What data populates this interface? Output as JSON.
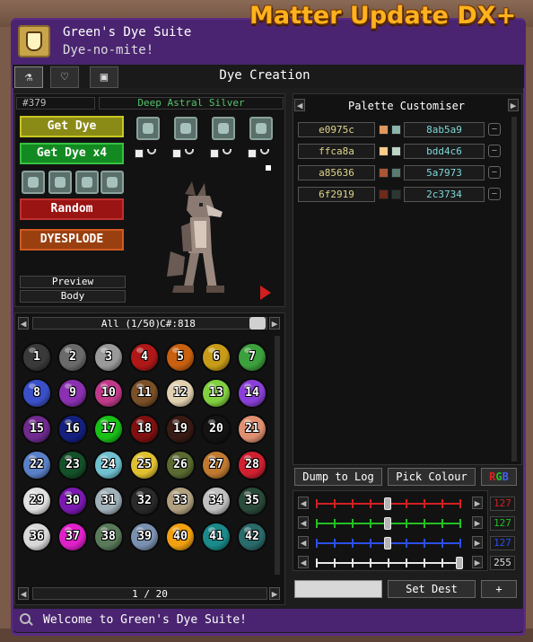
{
  "banner": {
    "text": "Matter Update DX+"
  },
  "window": {
    "title": "Green's Dye Suite",
    "subtitle": "Dye-no-mite!"
  },
  "tabs": [
    {
      "icon": "flask-icon",
      "active": true
    },
    {
      "icon": "heart-icon",
      "active": false
    },
    {
      "icon": "pot-icon",
      "active": false
    }
  ],
  "panel_title": "Dye Creation",
  "dye_header": {
    "id": "#379",
    "name": "Deep Astral Silver"
  },
  "buttons": {
    "get_dye": "Get Dye",
    "get_dye_x4": "Get Dye x4",
    "random": "Random",
    "dyesplode": "DYESPLODE"
  },
  "preview": {
    "label": "Preview",
    "slot": "Body"
  },
  "palette": {
    "title": "Palette Customiser",
    "rows": [
      {
        "from": "e0975c",
        "from_color": "#e0975c",
        "to": "8ab5a9",
        "to_color": "#8ab5a9"
      },
      {
        "from": "ffca8a",
        "from_color": "#ffca8a",
        "to": "bdd4c6",
        "to_color": "#bdd4c6"
      },
      {
        "from": "a85636",
        "from_color": "#a85636",
        "to": "5a7973",
        "to_color": "#5a7973"
      },
      {
        "from": "6f2919",
        "from_color": "#6f2919",
        "to": "2c3734",
        "to_color": "#2c3734"
      }
    ],
    "remove_label": "–"
  },
  "tools": {
    "dump": "Dump to Log",
    "pick": "Pick Colour",
    "mode": "RGB"
  },
  "sliders": [
    {
      "channel": "r",
      "color": "#d22020",
      "value": "127",
      "level": 0.5
    },
    {
      "channel": "g",
      "color": "#22c022",
      "value": "127",
      "level": 0.5
    },
    {
      "channel": "b",
      "color": "#2a50e8",
      "value": "127",
      "level": 0.5
    },
    {
      "channel": "a",
      "color": "#e8e8e8",
      "value": "255",
      "level": 1.0
    }
  ],
  "set_dest": {
    "label": "Set Dest",
    "plus": "+"
  },
  "list": {
    "filter": "All (1/50)",
    "count": "C#:818",
    "page": "1 / 20"
  },
  "dyes": [
    {
      "n": "1",
      "c": "#3a3a3a"
    },
    {
      "n": "2",
      "c": "#6a6a6a"
    },
    {
      "n": "3",
      "c": "#9a9a9a"
    },
    {
      "n": "4",
      "c": "#b01818"
    },
    {
      "n": "5",
      "c": "#c86010"
    },
    {
      "n": "6",
      "c": "#c89c18"
    },
    {
      "n": "7",
      "c": "#3ca03c"
    },
    {
      "n": "8",
      "c": "#3a50c8"
    },
    {
      "n": "9",
      "c": "#8a30b0"
    },
    {
      "n": "10",
      "c": "#c03a8a"
    },
    {
      "n": "11",
      "c": "#7a5028"
    },
    {
      "n": "12",
      "c": "#e0d0b0"
    },
    {
      "n": "13",
      "c": "#80d040"
    },
    {
      "n": "14",
      "c": "#8a40d8"
    },
    {
      "n": "15",
      "c": "#702a90"
    },
    {
      "n": "16",
      "c": "#142080"
    },
    {
      "n": "17",
      "c": "#18c018"
    },
    {
      "n": "18",
      "c": "#801010"
    },
    {
      "n": "19",
      "c": "#3a1a14"
    },
    {
      "n": "20",
      "c": "#141414"
    },
    {
      "n": "21",
      "c": "#e09070"
    },
    {
      "n": "22",
      "c": "#5a80c8"
    },
    {
      "n": "23",
      "c": "#145028"
    },
    {
      "n": "24",
      "c": "#70c0d0"
    },
    {
      "n": "25",
      "c": "#e0c030"
    },
    {
      "n": "26",
      "c": "#5a6a30"
    },
    {
      "n": "27",
      "c": "#c07a30"
    },
    {
      "n": "28",
      "c": "#d02030"
    },
    {
      "n": "29",
      "c": "#e0e0e0"
    },
    {
      "n": "30",
      "c": "#7a18b0"
    },
    {
      "n": "31",
      "c": "#a0b0b8"
    },
    {
      "n": "32",
      "c": "#2a2a2a"
    },
    {
      "n": "33",
      "c": "#b0a080"
    },
    {
      "n": "34",
      "c": "#c0c0c0"
    },
    {
      "n": "35",
      "c": "#2a4a3a"
    },
    {
      "n": "36",
      "c": "#d8d8d8"
    },
    {
      "n": "37",
      "c": "#e020c8"
    },
    {
      "n": "38",
      "c": "#5a7a5a"
    },
    {
      "n": "39",
      "c": "#7a90b0"
    },
    {
      "n": "40",
      "c": "#f0a010"
    },
    {
      "n": "41",
      "c": "#1a8a8a"
    },
    {
      "n": "42",
      "c": "#2a6a6a"
    }
  ],
  "status": "Welcome to Green's Dye Suite!"
}
